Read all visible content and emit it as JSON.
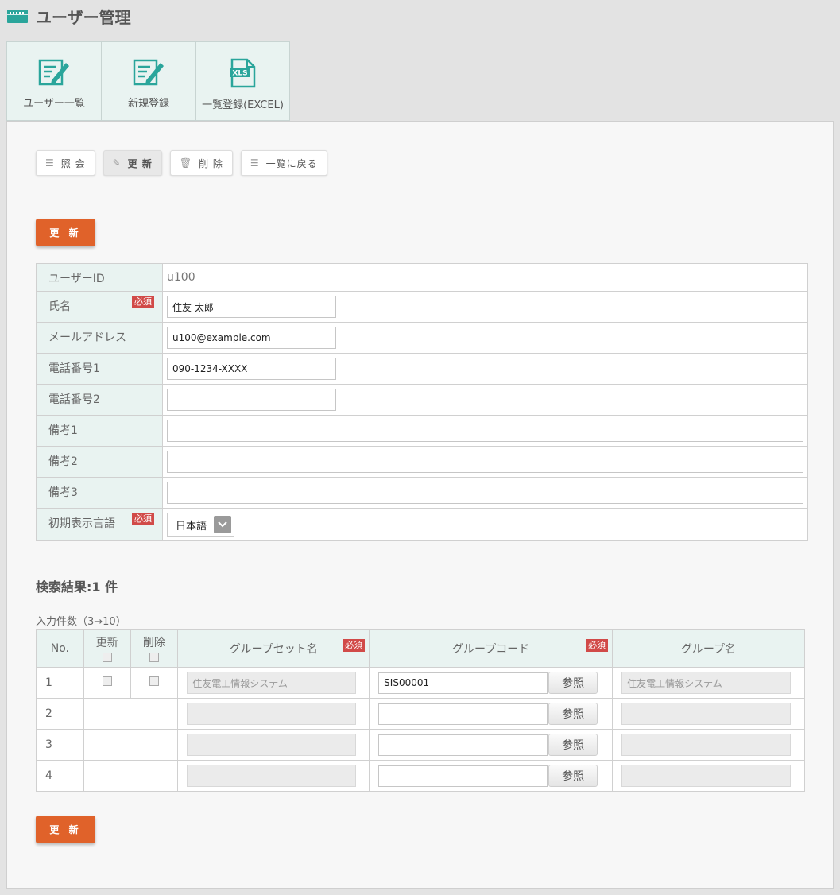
{
  "header": {
    "title": "ユーザー管理"
  },
  "top_tabs": [
    {
      "label": "ユーザー一覧"
    },
    {
      "label": "新規登録"
    },
    {
      "label": "一覧登録(EXCEL)",
      "badge": "XLS"
    }
  ],
  "sub_toolbar": {
    "view_label": "照 会",
    "update_label": "更 新",
    "delete_label": "削 除",
    "back_label": "一覧に戻る"
  },
  "update_button_label": "更 新",
  "form": {
    "user_id_label": "ユーザーID",
    "user_id_value": "u100",
    "name_label": "氏名",
    "name_value": "住友 太郎",
    "email_label": "メールアドレス",
    "email_value": "u100@example.com",
    "phone1_label": "電話番号1",
    "phone1_value": "090-1234-XXXX",
    "phone2_label": "電話番号2",
    "phone2_value": "",
    "note1_label": "備考1",
    "note1_value": "",
    "note2_label": "備考2",
    "note2_value": "",
    "note3_label": "備考3",
    "note3_value": "",
    "lang_label": "初期表示言語",
    "lang_value": "日本語",
    "required_badge": "必須"
  },
  "results": {
    "heading": "検索結果:1 件",
    "input_count_link": "入力件数（3→10）",
    "columns": {
      "no": "No.",
      "update": "更新",
      "delete": "削除",
      "group_set_name": "グループセット名",
      "group_code": "グループコード",
      "group_name": "グループ名"
    },
    "ref_label": "参照",
    "rows": [
      {
        "no": "1",
        "group_set_name": "住友電工情報システム",
        "group_code": "SIS00001",
        "group_name": "住友電工情報システム"
      },
      {
        "no": "2",
        "group_set_name": "",
        "group_code": "",
        "group_name": ""
      },
      {
        "no": "3",
        "group_set_name": "",
        "group_code": "",
        "group_name": ""
      },
      {
        "no": "4",
        "group_set_name": "",
        "group_code": "",
        "group_name": ""
      }
    ]
  },
  "colors": {
    "accent": "#e0622a",
    "teal": "#2aa59b",
    "required": "#d14a48",
    "label_bg": "#e9f3f1"
  }
}
